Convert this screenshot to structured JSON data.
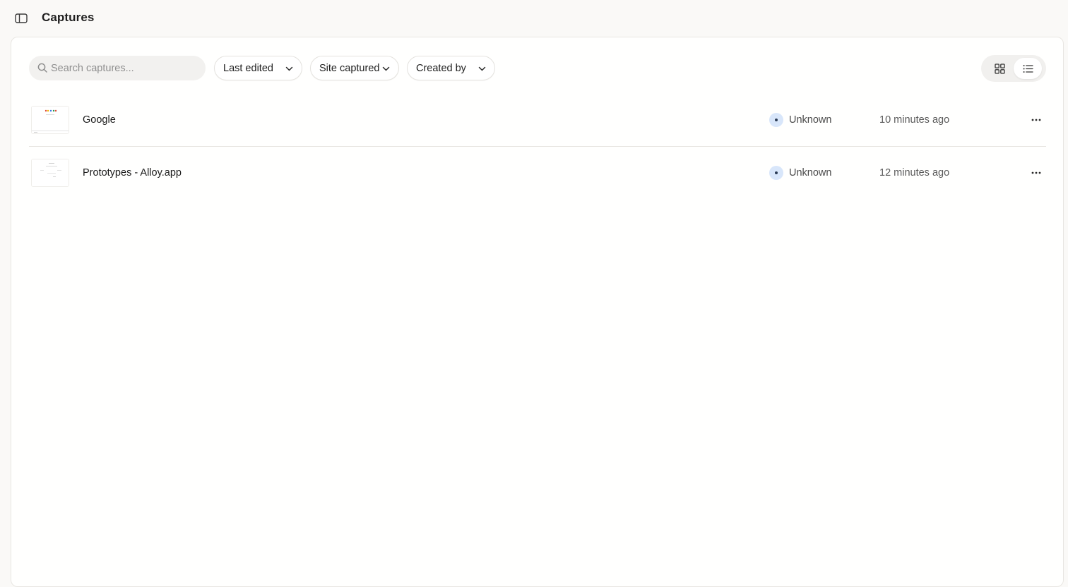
{
  "header": {
    "title": "Captures",
    "sidebar_toggle_icon": "sidebar-panel-icon"
  },
  "toolbar": {
    "search": {
      "placeholder": "Search captures...",
      "value": "",
      "icon": "search-icon"
    },
    "filters": [
      {
        "label": "Last edited",
        "icon": "chevron-down-icon"
      },
      {
        "label": "Site captured",
        "icon": "chevron-down-icon"
      },
      {
        "label": "Created by",
        "icon": "chevron-down-icon"
      }
    ],
    "view_modes": [
      {
        "name": "grid",
        "icon": "grid-view-icon",
        "active": false
      },
      {
        "name": "list",
        "icon": "list-view-icon",
        "active": true
      }
    ]
  },
  "captures": [
    {
      "name": "Google",
      "owner": "Unknown",
      "edited": "10 minutes ago",
      "menu_icon": "more-horizontal-icon"
    },
    {
      "name": "Prototypes - Alloy.app",
      "owner": "Unknown",
      "edited": "12 minutes ago",
      "menu_icon": "more-horizontal-icon"
    }
  ],
  "colors": {
    "background": "#faf9f7",
    "panel": "#fffffe",
    "avatar_bg": "#d8e6fa",
    "border": "#e8e6e2"
  }
}
